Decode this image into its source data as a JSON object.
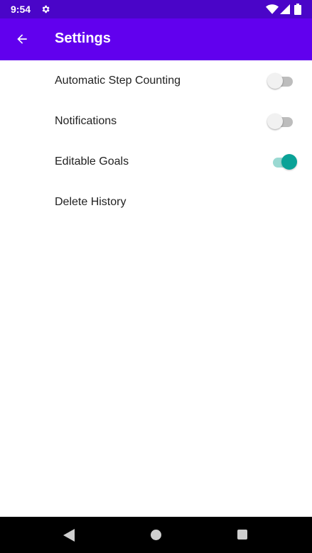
{
  "status_bar": {
    "time": "9:54",
    "icons": [
      "gear-icon",
      "wifi-icon",
      "signal-icon",
      "battery-icon"
    ]
  },
  "app_bar": {
    "title": "Settings",
    "back_icon": "arrow-back-icon",
    "color": "#6100ee"
  },
  "settings": {
    "items": [
      {
        "label": "Automatic Step Counting",
        "toggle": "off"
      },
      {
        "label": "Notifications",
        "toggle": "off"
      },
      {
        "label": "Editable Goals",
        "toggle": "on"
      },
      {
        "label": "Delete History"
      }
    ],
    "accent_color": "#0aa297"
  },
  "nav_bar": {
    "icons": [
      "nav-back-icon",
      "nav-home-icon",
      "nav-recents-icon"
    ]
  }
}
